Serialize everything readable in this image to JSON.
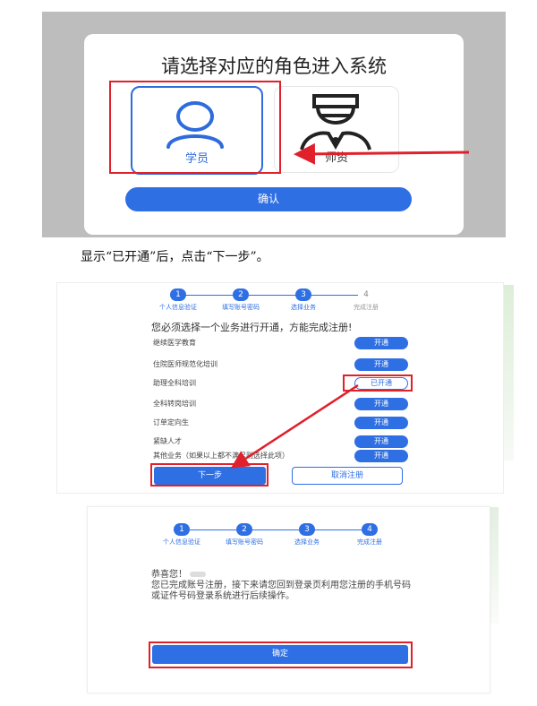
{
  "role_select": {
    "title": "请选择对应的角色进入系统",
    "roles": [
      {
        "label": "学员",
        "icon": "person-icon",
        "selected": true
      },
      {
        "label": "师资",
        "icon": "doctor-icon",
        "selected": false
      }
    ],
    "confirm_label": "确认"
  },
  "caption": "显示“已开通”后，点击“下一步”。",
  "business_select": {
    "steps": [
      {
        "num": "1",
        "label": "个人信息验证",
        "done": true
      },
      {
        "num": "2",
        "label": "填写账号密码",
        "done": true
      },
      {
        "num": "3",
        "label": "选择业务",
        "done": true
      },
      {
        "num": "4",
        "label": "完成注册",
        "done": false
      }
    ],
    "instruction": "您必须选择一个业务进行开通，方能完成注册!",
    "items": [
      {
        "name": "继续医学教育",
        "action": "开通",
        "opened": false
      },
      {
        "name": "住院医师规范化培训",
        "action": "开通",
        "opened": false
      },
      {
        "name": "助理全科培训",
        "action": "已开通",
        "opened": true
      },
      {
        "name": "全科转岗培训",
        "action": "开通",
        "opened": false
      },
      {
        "name": "订单定向生",
        "action": "开通",
        "opened": false
      },
      {
        "name": "紧缺人才",
        "action": "开通",
        "opened": false
      },
      {
        "name": "其他业务（如果以上都不满足则选择此项）",
        "action": "开通",
        "opened": false
      }
    ],
    "next_label": "下一步",
    "cancel_label": "取消注册"
  },
  "registration_complete": {
    "steps": [
      {
        "num": "1",
        "label": "个人信息验证",
        "done": true
      },
      {
        "num": "2",
        "label": "填写账号密码",
        "done": true
      },
      {
        "num": "3",
        "label": "选择业务",
        "done": true
      },
      {
        "num": "4",
        "label": "完成注册",
        "done": true
      }
    ],
    "greeting": "恭喜您！",
    "message": "您已完成账号注册，接下来请您回到登录页利用您注册的手机号码或证件号码登录系统进行后续操作。",
    "confirm_label": "确定"
  },
  "colors": {
    "accent": "#2f6fe4",
    "highlight": "#e0202a"
  }
}
